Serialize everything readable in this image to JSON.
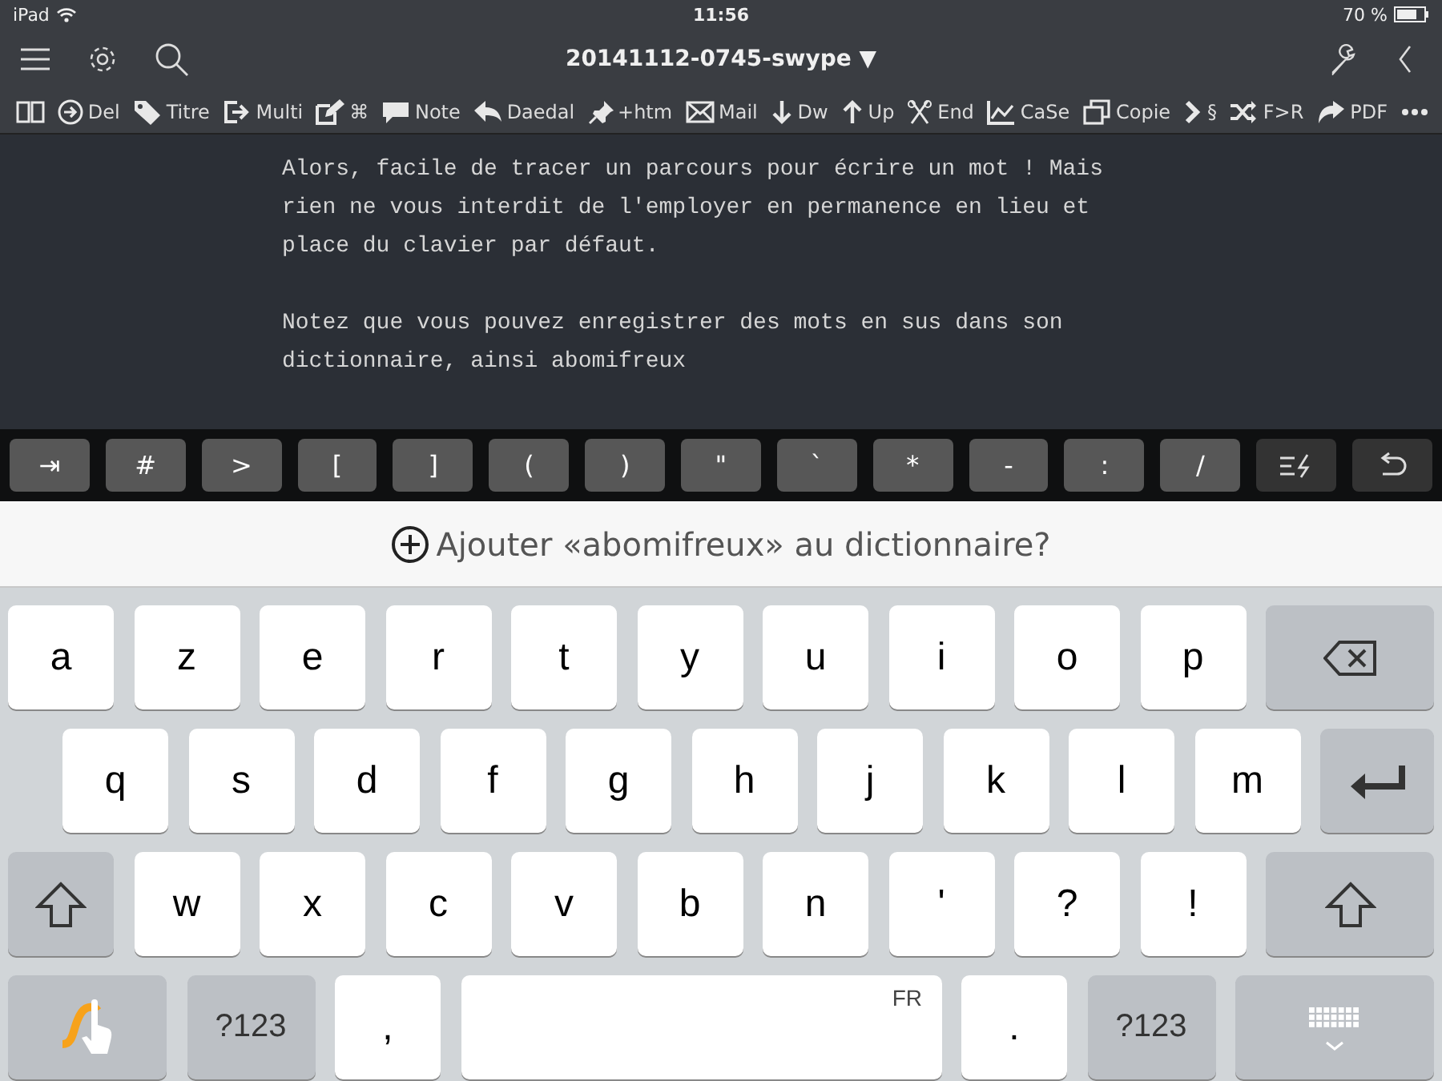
{
  "status_bar": {
    "device": "iPad",
    "time": "11:56",
    "battery": "70 %"
  },
  "nav": {
    "title": "20141112-0745-swype",
    "title_caret": "▼"
  },
  "toolbar": [
    {
      "kind": "book"
    },
    {
      "kind": "circle-arrow",
      "label": "Del"
    },
    {
      "kind": "tag",
      "label": "Titre"
    },
    {
      "kind": "exit",
      "label": "Multi"
    },
    {
      "kind": "edit",
      "label": "⌘"
    },
    {
      "kind": "speech",
      "label": "Note"
    },
    {
      "kind": "reply",
      "label": "Daedal"
    },
    {
      "kind": "pin",
      "label": "+htm"
    },
    {
      "kind": "mail",
      "label": "Mail"
    },
    {
      "kind": "down",
      "label": "Dw"
    },
    {
      "kind": "up",
      "label": "Up"
    },
    {
      "kind": "scissors",
      "label": "End"
    },
    {
      "kind": "chart",
      "label": "CaSe"
    },
    {
      "kind": "copy",
      "label": "Copie"
    },
    {
      "kind": "chevron",
      "label": "§"
    },
    {
      "kind": "shuffle",
      "label": "F>R"
    },
    {
      "kind": "share",
      "label": "PDF"
    },
    {
      "kind": "more"
    }
  ],
  "editor": {
    "paragraphs": [
      "Alors, facile de tracer un parcours pour écrire un mot ! Mais rien ne vous interdit de l'employer en permanence en lieu et place du clavier par défaut.",
      "Notez que vous pouvez enregistrer des mots en sus dans son dictionnaire, ainsi abomifreux"
    ]
  },
  "extra_keys": [
    {
      "kind": "text",
      "label": "⇥"
    },
    {
      "kind": "text",
      "label": "#"
    },
    {
      "kind": "text",
      "label": ">"
    },
    {
      "kind": "text",
      "label": "["
    },
    {
      "kind": "text",
      "label": "]"
    },
    {
      "kind": "text",
      "label": "("
    },
    {
      "kind": "text",
      "label": ")"
    },
    {
      "kind": "text",
      "label": "\""
    },
    {
      "kind": "text",
      "label": "`"
    },
    {
      "kind": "text",
      "label": "*"
    },
    {
      "kind": "text",
      "label": "-"
    },
    {
      "kind": "text",
      "label": ":"
    },
    {
      "kind": "text",
      "label": "/"
    },
    {
      "kind": "format"
    },
    {
      "kind": "undo"
    }
  ],
  "suggestion": {
    "text": "Ajouter «abomifreux» au dictionnaire?"
  },
  "keyboard": {
    "rows": [
      [
        {
          "kind": "letter",
          "label": "a"
        },
        {
          "kind": "letter",
          "label": "z"
        },
        {
          "kind": "letter",
          "label": "e"
        },
        {
          "kind": "letter",
          "label": "r"
        },
        {
          "kind": "letter",
          "label": "t"
        },
        {
          "kind": "letter",
          "label": "y"
        },
        {
          "kind": "letter",
          "label": "u"
        },
        {
          "kind": "letter",
          "label": "i"
        },
        {
          "kind": "letter",
          "label": "o"
        },
        {
          "kind": "letter",
          "label": "p"
        },
        {
          "kind": "backspace"
        }
      ],
      [
        {
          "kind": "letter",
          "label": "q"
        },
        {
          "kind": "letter",
          "label": "s"
        },
        {
          "kind": "letter",
          "label": "d"
        },
        {
          "kind": "letter",
          "label": "f"
        },
        {
          "kind": "letter",
          "label": "g"
        },
        {
          "kind": "letter",
          "label": "h"
        },
        {
          "kind": "letter",
          "label": "j"
        },
        {
          "kind": "letter",
          "label": "k"
        },
        {
          "kind": "letter",
          "label": "l"
        },
        {
          "kind": "letter",
          "label": "m"
        },
        {
          "kind": "return"
        }
      ],
      [
        {
          "kind": "shift"
        },
        {
          "kind": "letter",
          "label": "w"
        },
        {
          "kind": "letter",
          "label": "x"
        },
        {
          "kind": "letter",
          "label": "c"
        },
        {
          "kind": "letter",
          "label": "v"
        },
        {
          "kind": "letter",
          "label": "b"
        },
        {
          "kind": "letter",
          "label": "n"
        },
        {
          "kind": "letter",
          "label": "'"
        },
        {
          "kind": "letter",
          "label": "?"
        },
        {
          "kind": "letter",
          "label": "!"
        },
        {
          "kind": "shift"
        }
      ],
      [
        {
          "kind": "swype"
        },
        {
          "kind": "mode",
          "label": "?123"
        },
        {
          "kind": "letter",
          "label": ","
        },
        {
          "kind": "space",
          "label": "FR"
        },
        {
          "kind": "letter",
          "label": "."
        },
        {
          "kind": "mode",
          "label": "?123"
        },
        {
          "kind": "hide"
        }
      ]
    ]
  }
}
